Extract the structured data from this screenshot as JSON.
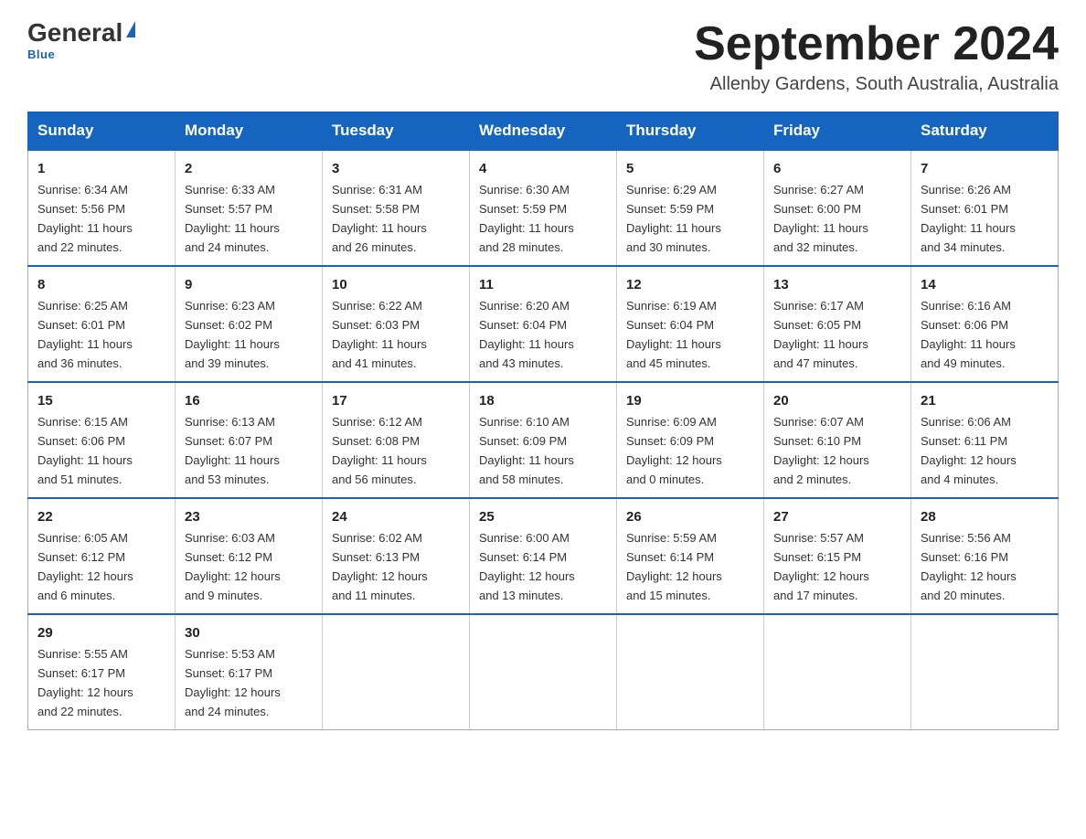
{
  "header": {
    "logo": {
      "general": "General",
      "triangle": "",
      "blue": "Blue"
    },
    "title": "September 2024",
    "location": "Allenby Gardens, South Australia, Australia"
  },
  "calendar": {
    "days_of_week": [
      "Sunday",
      "Monday",
      "Tuesday",
      "Wednesday",
      "Thursday",
      "Friday",
      "Saturday"
    ],
    "weeks": [
      [
        {
          "day": "1",
          "sunrise": "6:34 AM",
          "sunset": "5:56 PM",
          "daylight": "11 hours and 22 minutes."
        },
        {
          "day": "2",
          "sunrise": "6:33 AM",
          "sunset": "5:57 PM",
          "daylight": "11 hours and 24 minutes."
        },
        {
          "day": "3",
          "sunrise": "6:31 AM",
          "sunset": "5:58 PM",
          "daylight": "11 hours and 26 minutes."
        },
        {
          "day": "4",
          "sunrise": "6:30 AM",
          "sunset": "5:59 PM",
          "daylight": "11 hours and 28 minutes."
        },
        {
          "day": "5",
          "sunrise": "6:29 AM",
          "sunset": "5:59 PM",
          "daylight": "11 hours and 30 minutes."
        },
        {
          "day": "6",
          "sunrise": "6:27 AM",
          "sunset": "6:00 PM",
          "daylight": "11 hours and 32 minutes."
        },
        {
          "day": "7",
          "sunrise": "6:26 AM",
          "sunset": "6:01 PM",
          "daylight": "11 hours and 34 minutes."
        }
      ],
      [
        {
          "day": "8",
          "sunrise": "6:25 AM",
          "sunset": "6:01 PM",
          "daylight": "11 hours and 36 minutes."
        },
        {
          "day": "9",
          "sunrise": "6:23 AM",
          "sunset": "6:02 PM",
          "daylight": "11 hours and 39 minutes."
        },
        {
          "day": "10",
          "sunrise": "6:22 AM",
          "sunset": "6:03 PM",
          "daylight": "11 hours and 41 minutes."
        },
        {
          "day": "11",
          "sunrise": "6:20 AM",
          "sunset": "6:04 PM",
          "daylight": "11 hours and 43 minutes."
        },
        {
          "day": "12",
          "sunrise": "6:19 AM",
          "sunset": "6:04 PM",
          "daylight": "11 hours and 45 minutes."
        },
        {
          "day": "13",
          "sunrise": "6:17 AM",
          "sunset": "6:05 PM",
          "daylight": "11 hours and 47 minutes."
        },
        {
          "day": "14",
          "sunrise": "6:16 AM",
          "sunset": "6:06 PM",
          "daylight": "11 hours and 49 minutes."
        }
      ],
      [
        {
          "day": "15",
          "sunrise": "6:15 AM",
          "sunset": "6:06 PM",
          "daylight": "11 hours and 51 minutes."
        },
        {
          "day": "16",
          "sunrise": "6:13 AM",
          "sunset": "6:07 PM",
          "daylight": "11 hours and 53 minutes."
        },
        {
          "day": "17",
          "sunrise": "6:12 AM",
          "sunset": "6:08 PM",
          "daylight": "11 hours and 56 minutes."
        },
        {
          "day": "18",
          "sunrise": "6:10 AM",
          "sunset": "6:09 PM",
          "daylight": "11 hours and 58 minutes."
        },
        {
          "day": "19",
          "sunrise": "6:09 AM",
          "sunset": "6:09 PM",
          "daylight": "12 hours and 0 minutes."
        },
        {
          "day": "20",
          "sunrise": "6:07 AM",
          "sunset": "6:10 PM",
          "daylight": "12 hours and 2 minutes."
        },
        {
          "day": "21",
          "sunrise": "6:06 AM",
          "sunset": "6:11 PM",
          "daylight": "12 hours and 4 minutes."
        }
      ],
      [
        {
          "day": "22",
          "sunrise": "6:05 AM",
          "sunset": "6:12 PM",
          "daylight": "12 hours and 6 minutes."
        },
        {
          "day": "23",
          "sunrise": "6:03 AM",
          "sunset": "6:12 PM",
          "daylight": "12 hours and 9 minutes."
        },
        {
          "day": "24",
          "sunrise": "6:02 AM",
          "sunset": "6:13 PM",
          "daylight": "12 hours and 11 minutes."
        },
        {
          "day": "25",
          "sunrise": "6:00 AM",
          "sunset": "6:14 PM",
          "daylight": "12 hours and 13 minutes."
        },
        {
          "day": "26",
          "sunrise": "5:59 AM",
          "sunset": "6:14 PM",
          "daylight": "12 hours and 15 minutes."
        },
        {
          "day": "27",
          "sunrise": "5:57 AM",
          "sunset": "6:15 PM",
          "daylight": "12 hours and 17 minutes."
        },
        {
          "day": "28",
          "sunrise": "5:56 AM",
          "sunset": "6:16 PM",
          "daylight": "12 hours and 20 minutes."
        }
      ],
      [
        {
          "day": "29",
          "sunrise": "5:55 AM",
          "sunset": "6:17 PM",
          "daylight": "12 hours and 22 minutes."
        },
        {
          "day": "30",
          "sunrise": "5:53 AM",
          "sunset": "6:17 PM",
          "daylight": "12 hours and 24 minutes."
        },
        null,
        null,
        null,
        null,
        null
      ]
    ],
    "labels": {
      "sunrise": "Sunrise:",
      "sunset": "Sunset:",
      "daylight": "Daylight:"
    }
  }
}
